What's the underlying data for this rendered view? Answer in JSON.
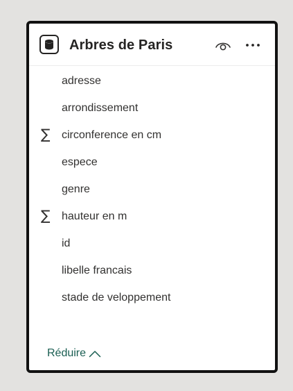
{
  "table": {
    "title": "Arbres de Paris",
    "icon": "database-icon",
    "header_actions": [
      "eye-icon",
      "more-icon"
    ]
  },
  "fields": [
    {
      "label": "adresse",
      "aggregate": false
    },
    {
      "label": "arrondissement",
      "aggregate": false
    },
    {
      "label": "circonference en cm",
      "aggregate": true
    },
    {
      "label": "espece",
      "aggregate": false
    },
    {
      "label": "genre",
      "aggregate": false
    },
    {
      "label": "hauteur en m",
      "aggregate": true
    },
    {
      "label": "id",
      "aggregate": false
    },
    {
      "label": "libelle francais",
      "aggregate": false
    },
    {
      "label": "stade de veloppement",
      "aggregate": false
    }
  ],
  "footer": {
    "collapse_label": "Réduire"
  },
  "colors": {
    "background": "#e3e2e0",
    "card_border": "#111111",
    "text": "#323130",
    "accent": "#1a5e52"
  }
}
